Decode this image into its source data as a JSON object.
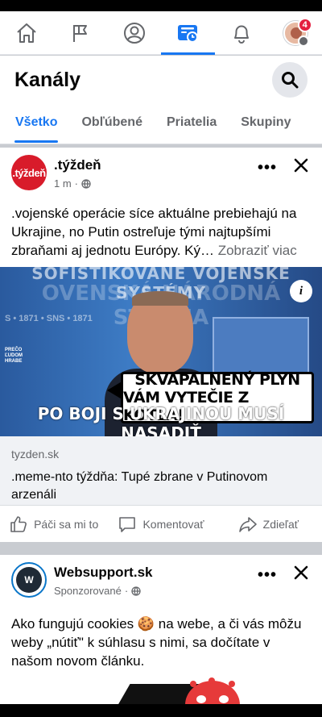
{
  "nav": {
    "tabs": [
      {
        "name": "home-icon"
      },
      {
        "name": "flag-icon"
      },
      {
        "name": "profile-icon"
      },
      {
        "name": "feeds-icon",
        "active": true
      },
      {
        "name": "bell-icon"
      },
      {
        "name": "avatar-menu"
      }
    ],
    "notification_count": "4"
  },
  "header": {
    "title": "Kanály",
    "tabs": [
      "Všetko",
      "Obľúbené",
      "Priatelia",
      "Skupiny"
    ]
  },
  "post1": {
    "page_name": ".týždeň",
    "avatar_text": ".týždeň",
    "time": "1 m",
    "more": "•••",
    "text": ".vojenské operácie síce aktuálne prebiehajú na Ukrajine, no Putin ostreľuje tými najtupšími zbraňami aj jednotu Európy. Ký…",
    "see_more": "Zobraziť viac",
    "image": {
      "banner_top": "SOFISTIKOVANÉ VOJENSKÉ SYSTÉMY",
      "banner_2": "OVENSKÁ NÁRODNÁ STRANA",
      "side_text": "S • 1871 • SNS • 1871",
      "small_text_1": "PREČO",
      "small_text_2": "ĽUDOM",
      "small_text_3": "HRABE",
      "speech_line_1": "SKVAPALNENÝ PLYN",
      "speech_line_2": "VÁM VYTEČIE Z KOTLA!",
      "bottom_text": "PO BOJI S UKRAJINOU MUSÍ NASADIŤ",
      "info": "i"
    },
    "link_domain": "tyzden.sk",
    "link_title": ".meme-nto týždňa: Tupé zbrane v Putinovom arzenáli",
    "actions": {
      "like": "Páči sa mi to",
      "comment": "Komentovať",
      "share": "Zdieľať"
    }
  },
  "post2": {
    "page_name": "Websupport.sk",
    "avatar_text": "W",
    "meta": "Sponzorované",
    "more": "•••",
    "text_before": "Ako fungujú cookies ",
    "emoji": "🍪",
    "text_after": " na webe, a či vás môžu weby „nútiť\" k súhlasu s nimi, sa dočítate v našom novom článku."
  },
  "colors": {
    "accent": "#1877f2",
    "tyzden_red": "#d81b2a",
    "badge": "#e41e3f"
  }
}
